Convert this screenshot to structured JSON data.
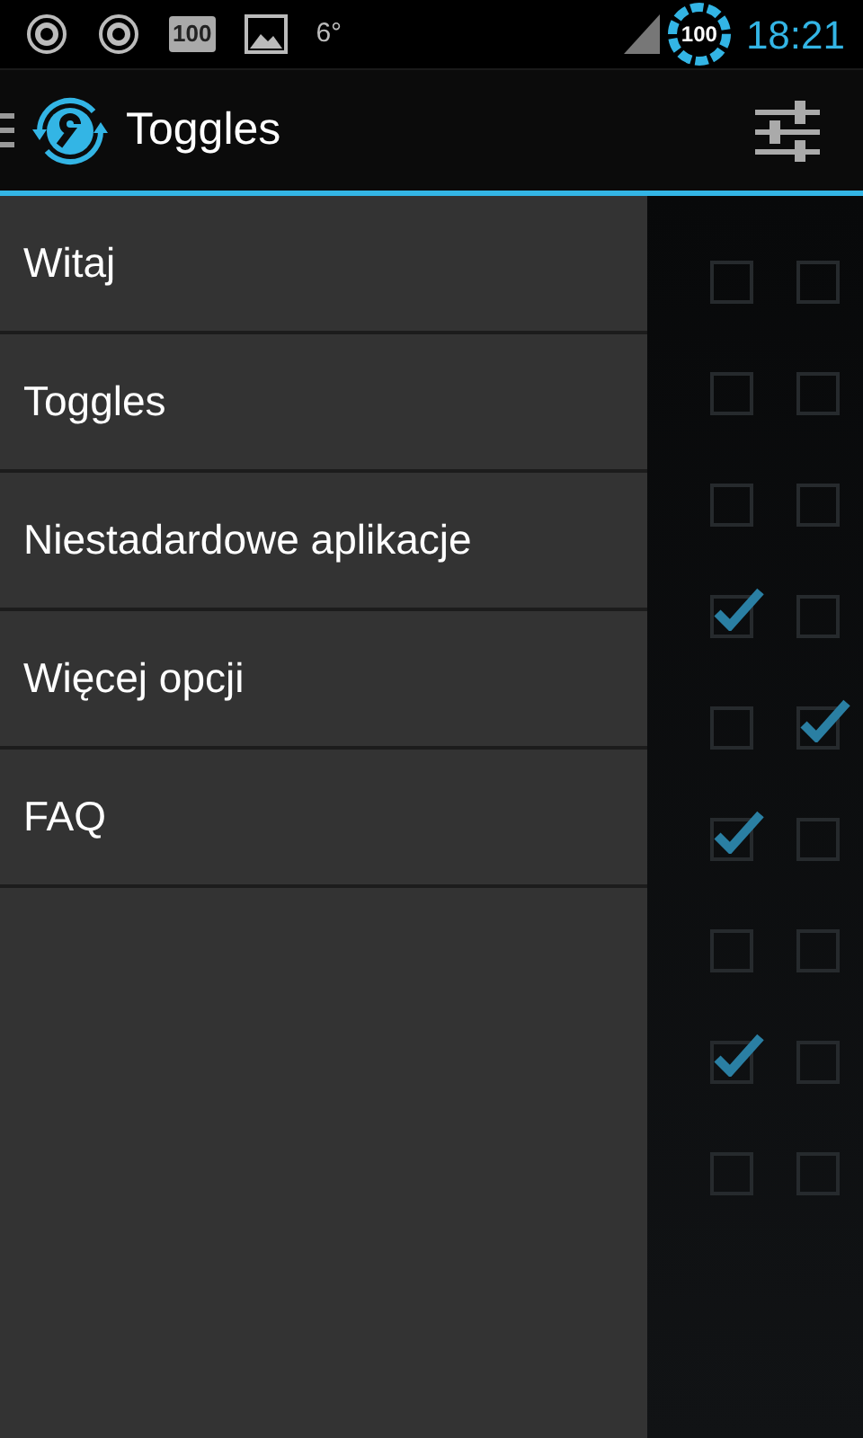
{
  "status_bar": {
    "notification_badge": "100",
    "temperature": "6°",
    "battery": "100",
    "time": "18:21"
  },
  "action_bar": {
    "title": "Toggles"
  },
  "drawer": {
    "items": [
      {
        "label": "Witaj"
      },
      {
        "label": "Toggles"
      },
      {
        "label": "Niestadardowe aplikacje"
      },
      {
        "label": "Więcej opcji"
      },
      {
        "label": "FAQ"
      }
    ]
  },
  "toggle_rows": [
    {
      "first_checked": false,
      "second_checked": false
    },
    {
      "first_checked": false,
      "second_checked": false
    },
    {
      "first_checked": false,
      "second_checked": false
    },
    {
      "first_checked": true,
      "second_checked": false
    },
    {
      "first_checked": false,
      "second_checked": true
    },
    {
      "first_checked": true,
      "second_checked": false
    },
    {
      "first_checked": false,
      "second_checked": false
    },
    {
      "first_checked": true,
      "second_checked": false
    },
    {
      "first_checked": false,
      "second_checked": false
    }
  ]
}
